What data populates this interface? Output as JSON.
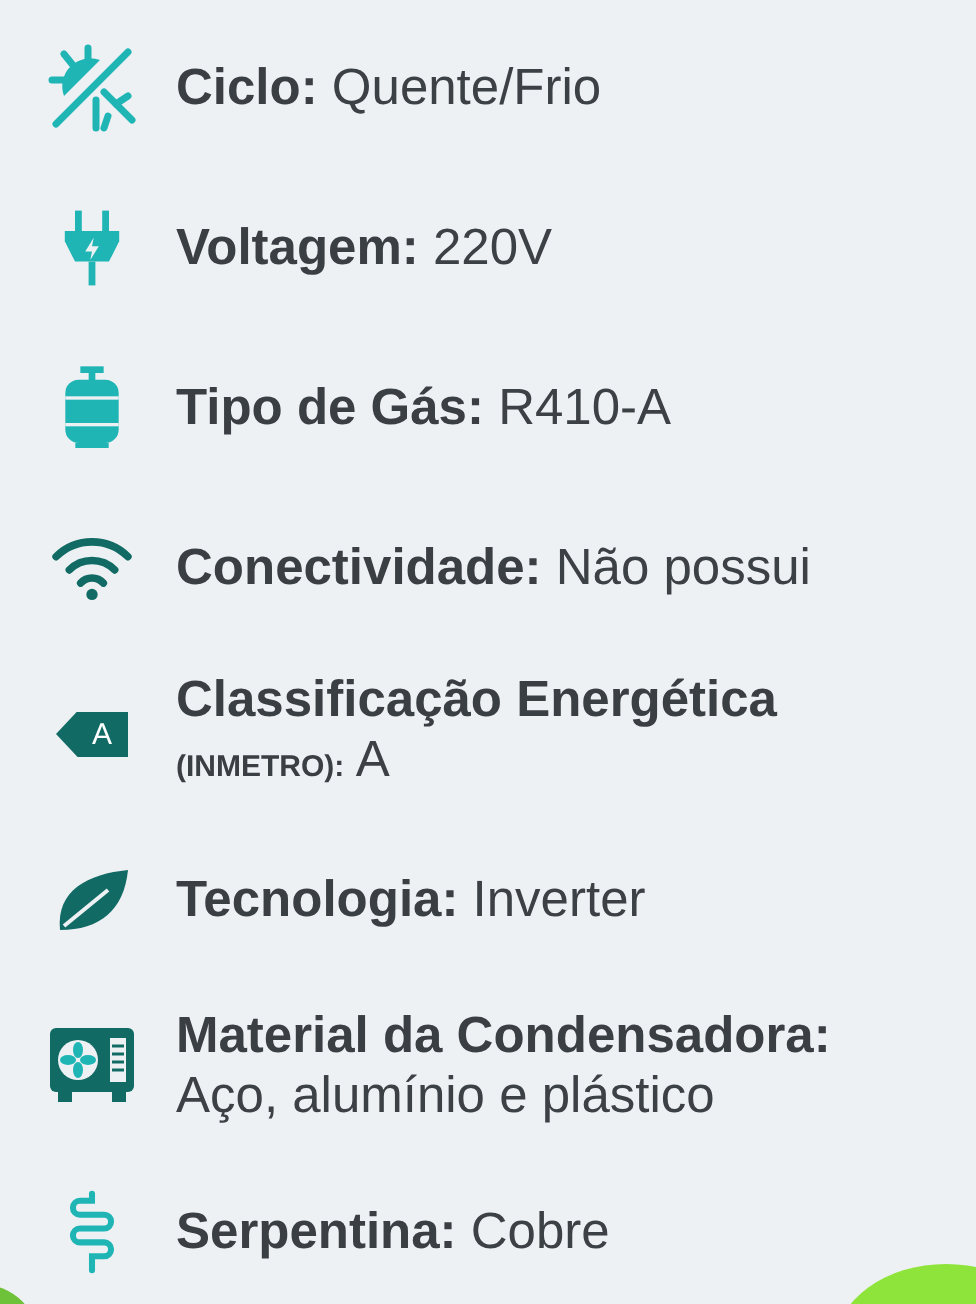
{
  "specs": [
    {
      "kind": "climate",
      "lines": [
        "**Ciclo:** Quente/Frio"
      ]
    },
    {
      "kind": "plug",
      "lines": [
        "**Voltagem:** 220V"
      ]
    },
    {
      "kind": "gas",
      "lines": [
        "**Tipo de Gás:** R410-A"
      ]
    },
    {
      "kind": "wifi",
      "lines": [
        "**Conectividade:** Não possui"
      ]
    },
    {
      "kind": "energy",
      "badge": "A",
      "lines": [
        "**Classificação Energética**",
        "**(INMETRO):** A"
      ]
    },
    {
      "kind": "leaf",
      "lines": [
        "**Tecnologia:** Inverter"
      ]
    },
    {
      "kind": "condenser",
      "lines": [
        "**Material da Condensadora:**",
        "Aço, alumínio e plástico"
      ]
    },
    {
      "kind": "coil",
      "lines": [
        "**Serpentina:** Cobre"
      ]
    }
  ]
}
